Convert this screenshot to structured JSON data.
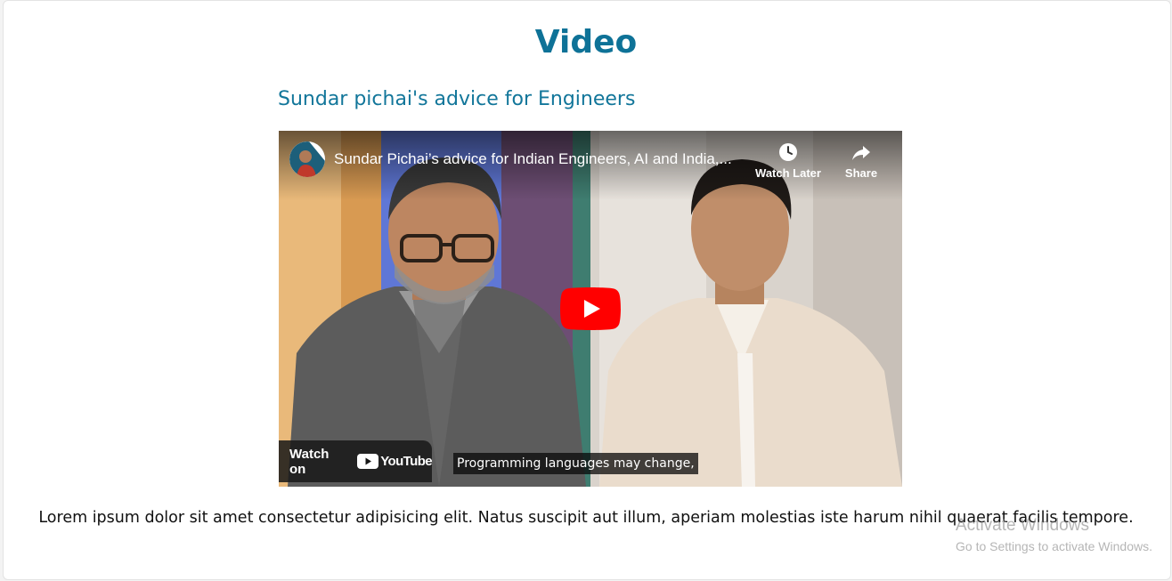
{
  "page": {
    "title": "Video",
    "body_text": "Lorem ipsum dolor sit amet consectetur adipisicing elit. Natus suscipit aut illum, aperiam molestias iste harum nihil quaerat facilis tempore."
  },
  "video": {
    "heading": "Sundar pichai's advice for Engineers",
    "player": {
      "title": "Sundar Pichai’s advice for Indian Engineers, AI and India,...",
      "watch_later_label": "Watch Later",
      "share_label": "Share",
      "watch_on_label": "Watch on",
      "youtube_logo_text": "YouTube",
      "caption": "Programming languages may change,",
      "icons": [
        "clock-icon",
        "share-arrow-icon",
        "play-icon",
        "youtube-logo"
      ]
    }
  },
  "watermark": {
    "title": "Activate Windows",
    "subtitle": "Go to Settings to activate Windows."
  },
  "colors": {
    "accent": "#0e7297",
    "youtube_red": "#ff0000"
  }
}
